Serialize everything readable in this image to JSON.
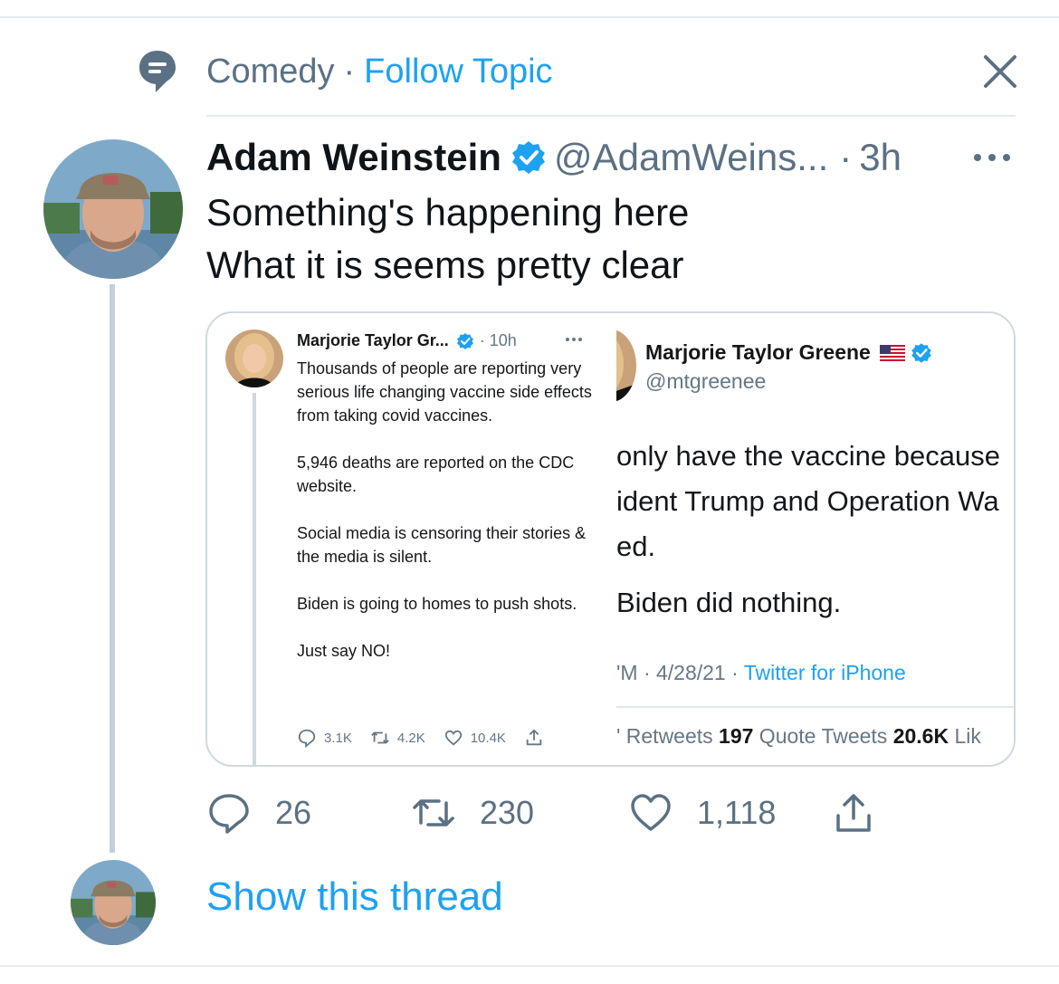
{
  "topic": {
    "name": "Comedy",
    "separator": "·",
    "follow_label": "Follow Topic"
  },
  "tweet": {
    "author_name": "Adam Weinstein",
    "handle": "@AdamWeins...",
    "separator": "·",
    "time": "3h",
    "text_lines": [
      "Something's happening here",
      "What it is seems pretty clear"
    ],
    "actions": {
      "replies": "26",
      "retweets": "230",
      "likes": "1,118"
    }
  },
  "embedded_left": {
    "author_name": "Marjorie Taylor Gr...",
    "time": "· 10h",
    "paragraphs": [
      "Thousands of people are reporting very serious life changing vaccine side effects from taking covid vaccines.",
      "5,946 deaths are reported on the CDC website.",
      "Social media is censoring their stories & the media is silent.",
      "Biden is going to homes to push shots.",
      "Just say NO!"
    ],
    "replies": "3.1K",
    "retweets": "4.2K",
    "likes": "10.4K"
  },
  "embedded_right": {
    "author_name": "Marjorie Taylor Greene",
    "handle": "@mtgreenee",
    "lines": [
      "only have the vaccine because",
      "ident Trump and Operation Wa",
      "ed.",
      "Biden did nothing."
    ],
    "meta_time": "'M · 4/28/21 · ",
    "meta_via": "Twitter for iPhone",
    "stats_prefix": "' Retweets ",
    "quote_count": "197",
    "quote_label": " Quote Tweets ",
    "likes_count": "20.6K",
    "likes_label": " Lik"
  },
  "show_thread_label": "Show this thread",
  "colors": {
    "accent": "#1da1f2",
    "secondary_text": "#5b7083",
    "divider": "#e6ecf0"
  },
  "icons": [
    "topic-icon",
    "close-icon",
    "verified-icon",
    "more-icon",
    "reply-icon",
    "retweet-icon",
    "like-icon",
    "share-icon",
    "us-flag-icon"
  ]
}
